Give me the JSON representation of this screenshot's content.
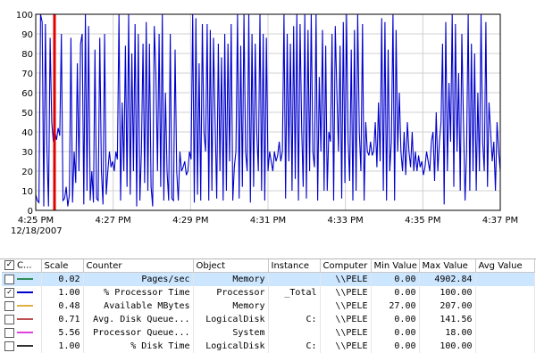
{
  "chart_data": {
    "type": "line",
    "ylim": [
      0,
      100
    ],
    "y_ticks": [
      "100",
      "90",
      "80",
      "70",
      "60",
      "50",
      "40",
      "30",
      "20",
      "10",
      "0"
    ],
    "x_ticks": [
      "4:25 PM",
      "4:27 PM",
      "4:29 PM",
      "4:31 PM",
      "4:33 PM",
      "4:35 PM",
      "4:37 PM"
    ],
    "x_date": "12/18/2007",
    "grid": true,
    "series": [
      {
        "name": "% Processor Time",
        "color": "#0000cc",
        "values": [
          8,
          5,
          4,
          100,
          96,
          2,
          95,
          30,
          2,
          88,
          45,
          35,
          40,
          36,
          42,
          38,
          90,
          5,
          6,
          12,
          2,
          8,
          88,
          4,
          30,
          14,
          75,
          20,
          85,
          90,
          3,
          100,
          10,
          94,
          5,
          20,
          4,
          82,
          6,
          5,
          88,
          20,
          3,
          90,
          8,
          20,
          30,
          22,
          25,
          20,
          30,
          26,
          100,
          5,
          55,
          20,
          84,
          12,
          100,
          8,
          80,
          20,
          95,
          2,
          90,
          5,
          30,
          85,
          14,
          96,
          10,
          85,
          12,
          2,
          94,
          70,
          20,
          90,
          12,
          100,
          5,
          60,
          20,
          5,
          90,
          6,
          5,
          82,
          20,
          5,
          30,
          20,
          22,
          25,
          18,
          20,
          30,
          26,
          100,
          4,
          98,
          8,
          75,
          5,
          95,
          40,
          30,
          95,
          5,
          92,
          10,
          88,
          45,
          6,
          85,
          20,
          78,
          5,
          90,
          10,
          85,
          25,
          95,
          5,
          22,
          30,
          100,
          6,
          84,
          12,
          100,
          30,
          20,
          100,
          4,
          90,
          12,
          85,
          40,
          20,
          100,
          10,
          90,
          5,
          88,
          20,
          30,
          25,
          20,
          30,
          25,
          28,
          35,
          25,
          30,
          100,
          6,
          90,
          25,
          85,
          10,
          94,
          16,
          100,
          5,
          95,
          42,
          12,
          100,
          6,
          92,
          20,
          100,
          30,
          22,
          100,
          5,
          68,
          30,
          92,
          10,
          84,
          10,
          40,
          35,
          90,
          5,
          94,
          60,
          30,
          84,
          6,
          96,
          14,
          100,
          35,
          15,
          82,
          5,
          92,
          10,
          100,
          40,
          20,
          95,
          5,
          45,
          30,
          28,
          35,
          28,
          30,
          45,
          22,
          55,
          25,
          98,
          10,
          96,
          5,
          82,
          20,
          35,
          100,
          5,
          92,
          30,
          60,
          30,
          20,
          40,
          18,
          45,
          30,
          22,
          40,
          20,
          30,
          20,
          28,
          22,
          25,
          18,
          22,
          30,
          25,
          20,
          35,
          40,
          15,
          50,
          20,
          35,
          45,
          85,
          3,
          96,
          20,
          65,
          35,
          100,
          12,
          95,
          30,
          70,
          10,
          90,
          45,
          5,
          30,
          100,
          10,
          85,
          20,
          80,
          10,
          60,
          20,
          100,
          35,
          20,
          96,
          12,
          55,
          40,
          25,
          35,
          10,
          45,
          30,
          20
        ]
      },
      {
        "name": "Time Bar",
        "color": "#e00000",
        "values": []
      }
    ]
  },
  "legend": {
    "headers": [
      "C...",
      "Scale",
      "Counter",
      "Object",
      "Instance",
      "Computer",
      "Min Value",
      "Max Value",
      "Avg Value"
    ],
    "rows": [
      {
        "checked": false,
        "color": "#2e8b57",
        "scale": "0.02",
        "counter": "Pages/sec",
        "object": "Memory",
        "instance": "",
        "computer": "\\\\PELE",
        "min": "0.00",
        "max": "4902.84",
        "avg": ""
      },
      {
        "checked": true,
        "color": "#0000cc",
        "scale": "1.00",
        "counter": "% Processor Time",
        "object": "Processor",
        "instance": "_Total",
        "computer": "\\\\PELE",
        "min": "0.00",
        "max": "100.00",
        "avg": ""
      },
      {
        "checked": false,
        "color": "#e0b040",
        "scale": "0.48",
        "counter": "Available MBytes",
        "object": "Memory",
        "instance": "",
        "computer": "\\\\PELE",
        "min": "27.00",
        "max": "207.00",
        "avg": ""
      },
      {
        "checked": false,
        "color": "#c05050",
        "scale": "0.71",
        "counter": "Avg. Disk Queue...",
        "object": "LogicalDisk",
        "instance": "C:",
        "computer": "\\\\PELE",
        "min": "0.00",
        "max": "141.56",
        "avg": ""
      },
      {
        "checked": false,
        "color": "#e040e0",
        "scale": "5.56",
        "counter": "Processor Queue...",
        "object": "System",
        "instance": "",
        "computer": "\\\\PELE",
        "min": "0.00",
        "max": "18.00",
        "avg": ""
      },
      {
        "checked": false,
        "color": "#303030",
        "scale": "1.00",
        "counter": "% Disk Time",
        "object": "LogicalDisk",
        "instance": "C:",
        "computer": "\\\\PELE",
        "min": "0.00",
        "max": "100.00",
        "avg": ""
      }
    ]
  }
}
